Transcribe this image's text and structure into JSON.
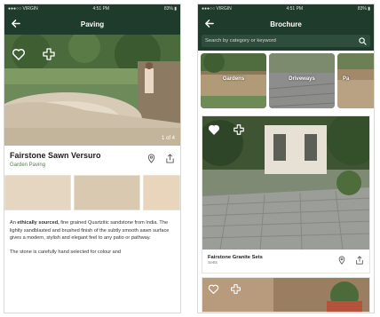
{
  "colors": {
    "header_bg": "#1f3b2c",
    "search_bg": "#2f4d3c",
    "subtitle_green": "#5a7a52"
  },
  "left_screen": {
    "status_bar": {
      "carrier": "●●●○○ VIRGIN",
      "time": "4:51 PM",
      "battery": "83% ▮"
    },
    "nav": {
      "title": "Paving",
      "back_icon": "arrow-left-icon"
    },
    "gallery": {
      "counter": "1 of 4",
      "favorite_icon": "heart-outline-icon",
      "add_icon": "cross-add-icon"
    },
    "product": {
      "name": "Fairstone Sawn Versuro",
      "category": "Garden Paving",
      "location_icon": "map-pin-icon",
      "share_icon": "share-icon"
    },
    "swatches": [
      {
        "name": "swatch-1",
        "color": "#e4d6c0"
      },
      {
        "name": "swatch-2",
        "color": "#d9c9b1"
      },
      {
        "name": "swatch-3",
        "color": "#e8d5bc"
      }
    ],
    "description": {
      "p1_pre": "An ",
      "p1_bold": "ethically sourced,",
      "p1_post": " fine grained Quartzitic sandstone from India. The lightly sandblasted and brushed finish of the subtly smooth sawn surface gives a modern, stylish and elegant feel to any patio or pathway.",
      "p2": "The stone is carefully hand selected for colour and"
    }
  },
  "right_screen": {
    "status_bar": {
      "carrier": "●●●○○ VIRGIN",
      "time": "4:51 PM",
      "battery": "83% ▮"
    },
    "nav": {
      "title": "Brochure",
      "back_icon": "arrow-left-icon"
    },
    "search": {
      "placeholder": "Search by category or keyword",
      "icon": "search-icon"
    },
    "categories": [
      {
        "label": "Gardens"
      },
      {
        "label": "Driveways"
      },
      {
        "label": "Pa"
      }
    ],
    "card": {
      "title": "Fairstone Granite Sets",
      "subtitle": "Setts",
      "favorite_icon": "heart-filled-icon",
      "add_icon": "cross-add-icon",
      "location_icon": "map-pin-icon",
      "share_icon": "share-icon"
    },
    "next_card": {
      "favorite_icon": "heart-outline-icon",
      "add_icon": "cross-add-icon"
    }
  }
}
